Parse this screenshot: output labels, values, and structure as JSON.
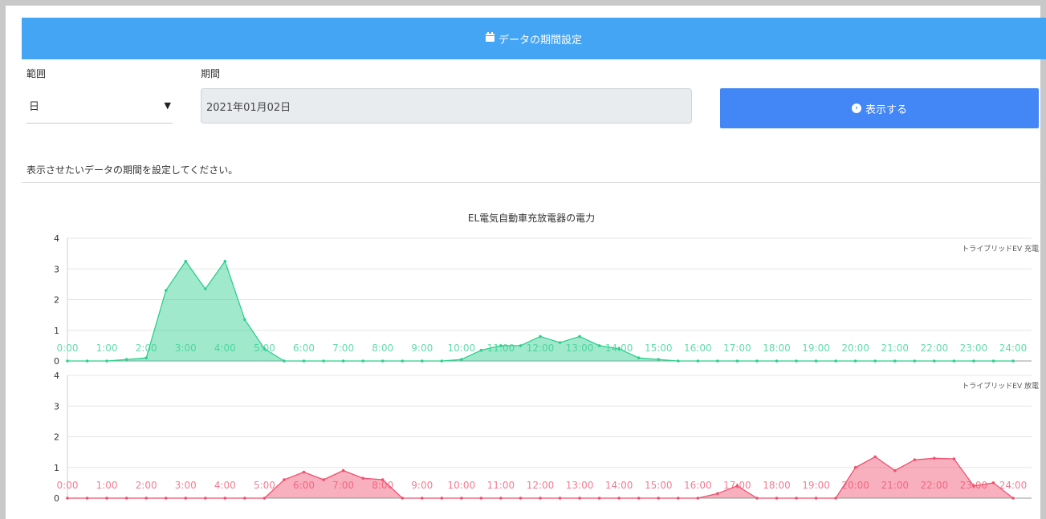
{
  "header": {
    "title": "データの期間設定",
    "icon": "calendar-icon"
  },
  "form": {
    "range_label": "範囲",
    "range_value": "日",
    "period_label": "期間",
    "period_value": "2021年01月02日",
    "submit_label": "表示する",
    "help_text": "表示させたいデータの期間を設定してください。"
  },
  "chart_data": {
    "type": "area",
    "title": "EL電気自動車充放電器の電力",
    "x": [
      "0:00",
      "0:30",
      "1:00",
      "1:30",
      "2:00",
      "2:30",
      "3:00",
      "3:30",
      "4:00",
      "4:30",
      "5:00",
      "5:30",
      "6:00",
      "6:30",
      "7:00",
      "7:30",
      "8:00",
      "8:30",
      "9:00",
      "9:30",
      "10:00",
      "10:30",
      "11:00",
      "11:30",
      "12:00",
      "12:30",
      "13:00",
      "13:30",
      "14:00",
      "14:30",
      "15:00",
      "15:30",
      "16:00",
      "16:30",
      "17:00",
      "17:30",
      "18:00",
      "18:30",
      "19:00",
      "19:30",
      "20:00",
      "20:30",
      "21:00",
      "21:30",
      "22:00",
      "22:30",
      "23:00",
      "23:30",
      "24:00"
    ],
    "tick_labels": [
      "0:00",
      "1:00",
      "2:00",
      "3:00",
      "4:00",
      "5:00",
      "6:00",
      "7:00",
      "8:00",
      "9:00",
      "10:00",
      "11:00",
      "12:00",
      "13:00",
      "14:00",
      "15:00",
      "16:00",
      "17:00",
      "18:00",
      "19:00",
      "20:00",
      "21:00",
      "22:00",
      "23:00",
      "24:00"
    ],
    "yticks": [
      0,
      1,
      2,
      3,
      4
    ],
    "ylim": [
      0,
      4
    ],
    "series": [
      {
        "name": "トライブリッドEV 充電",
        "color": "#2ecf8f",
        "values": [
          0,
          0,
          0,
          0.05,
          0.1,
          2.3,
          3.25,
          2.35,
          3.25,
          1.35,
          0.4,
          0,
          0,
          0,
          0,
          0,
          0,
          0,
          0,
          0,
          0.05,
          0.35,
          0.5,
          0.5,
          0.8,
          0.6,
          0.8,
          0.5,
          0.4,
          0.1,
          0.05,
          0,
          0,
          0,
          0,
          0,
          0,
          0,
          0,
          0,
          0,
          0,
          0,
          0,
          0,
          0,
          0,
          0,
          0
        ]
      },
      {
        "name": "トライブリッドEV 放電",
        "color": "#f0506e",
        "values": [
          0,
          0,
          0,
          0,
          0,
          0,
          0,
          0,
          0,
          0,
          0,
          0.6,
          0.85,
          0.6,
          0.9,
          0.65,
          0.6,
          0,
          0,
          0,
          0,
          0,
          0,
          0,
          0,
          0,
          0,
          0,
          0,
          0,
          0,
          0,
          0,
          0.15,
          0.4,
          0,
          0,
          0,
          0,
          0,
          1.0,
          1.35,
          0.9,
          1.25,
          1.3,
          1.28,
          0.4,
          0.5,
          0
        ]
      }
    ]
  }
}
